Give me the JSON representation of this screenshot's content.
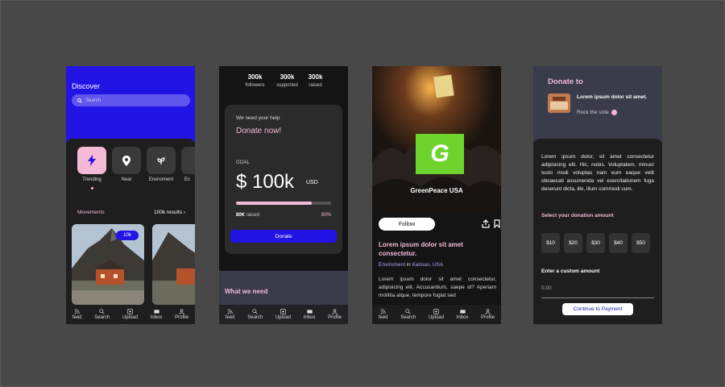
{
  "nav_items": [
    "feed",
    "Search",
    "Upload",
    "Inbox",
    "Profile"
  ],
  "screen1": {
    "title": "Discover",
    "search_placeholder": "Search",
    "categories": [
      "Trending",
      "Near",
      "Enviroment",
      "Ec"
    ],
    "movements_label": "Movements",
    "results": "100k results",
    "badge": "10k"
  },
  "screen2": {
    "stats": [
      {
        "value": "300k",
        "label": "followers"
      },
      {
        "value": "300k",
        "label": "supported"
      },
      {
        "value": "300k",
        "label": "raised"
      }
    ],
    "help": "We need your help",
    "donate_now": "Donate now!",
    "goal_label": "GOAL",
    "goal_amount": "$ 100k",
    "currency": "USD",
    "raised_value": "80K",
    "raised_label": "raised",
    "percent": "80%",
    "progress": 0.8,
    "donate_button": "Donate",
    "what_we_need": "What we need"
  },
  "screen3": {
    "org_name": "GreenPeace USA",
    "logo_letter": "G",
    "follow": "Follow",
    "post_title": "Lorem ipsum dolor sit amet consectetur.",
    "tag": "Enviroment",
    "in_word": "in",
    "location": "Kansas, USA",
    "body": "Lorem ipsum dolor sit amet consectetur, adipisicing elit. Accusantium, saepe id? Aperiam mollitia atque, tempore fugiat sed"
  },
  "screen4": {
    "title": "Donate to",
    "campaign": "Lorem ipsum dolor sit amet.",
    "campaign_sub": "Rock the vote",
    "body": "Lorem ipsum dolor, sit amet consectetur adipisicing elit. Hic, nobis. Voluptatem, minus! Iusto modi voluptas nam eum eaque velit obcaecati assumenda vel exercitationem fuga deserunt dicta, illo, illum commodi cum.",
    "select_label": "Select your donation amount",
    "amounts": [
      "$10",
      "$20",
      "$30",
      "$40",
      "$50"
    ],
    "custom_label": "Enter a custom amount",
    "custom_value": "0.00",
    "continue": "Continue to Payment"
  },
  "colors": {
    "accent": "#2314e6",
    "pink": "#f4b9d7",
    "green": "#6fd32e"
  }
}
